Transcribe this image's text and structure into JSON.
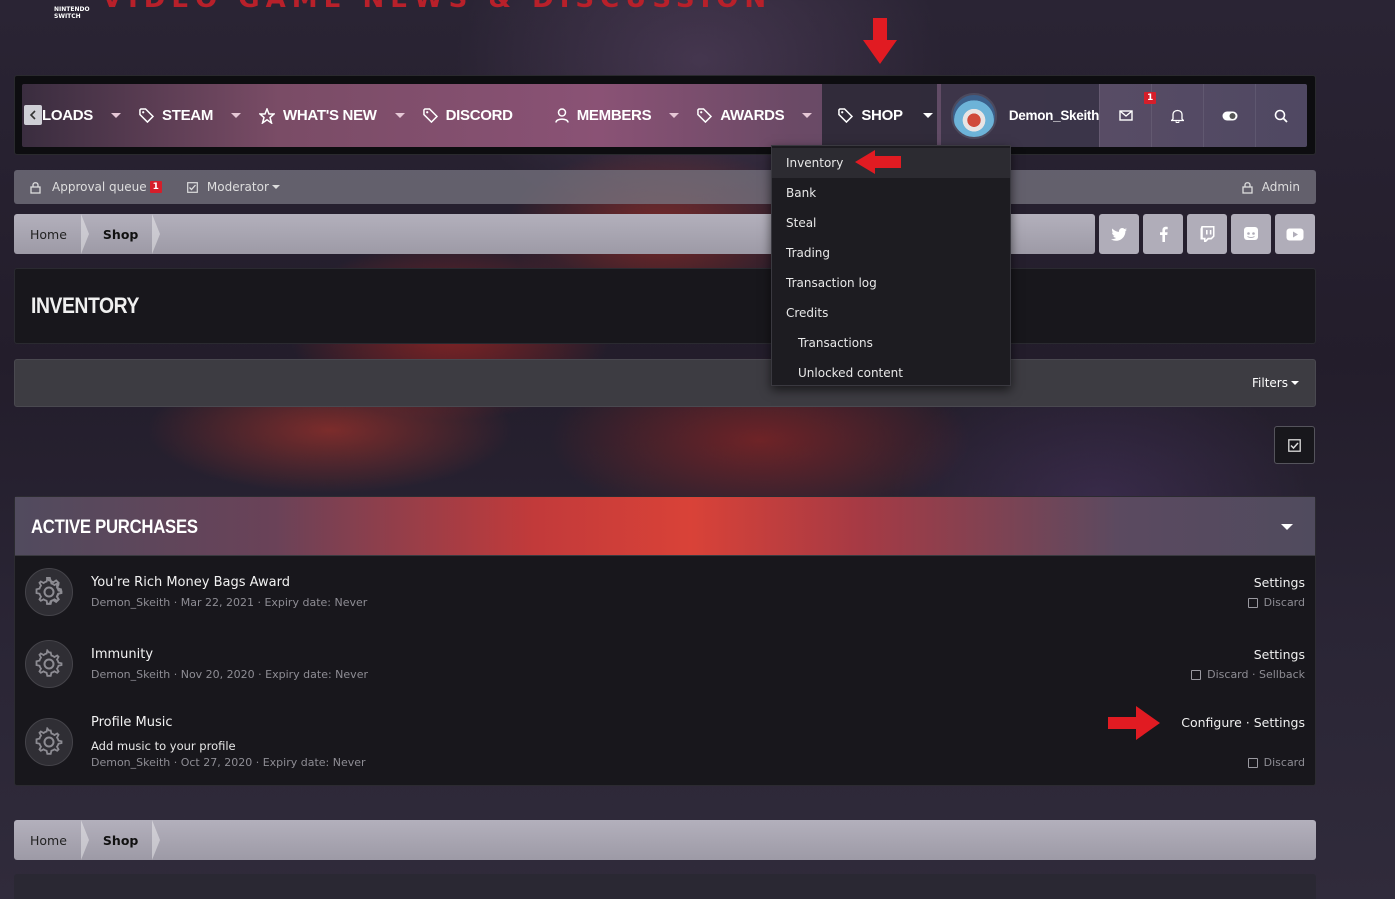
{
  "header": {
    "logo_text": "NINTENDO SWITCH",
    "tagline": "VIDEO GAME NEWS & DISCUSSION"
  },
  "nav": {
    "items": [
      {
        "label": "LOADS",
        "icon": "none"
      },
      {
        "label": "STEAM",
        "icon": "tag-icon"
      },
      {
        "label": "WHAT'S NEW",
        "icon": "star-icon"
      },
      {
        "label": "DISCORD",
        "icon": "tag-icon"
      },
      {
        "label": "MEMBERS",
        "icon": "user-icon"
      },
      {
        "label": "AWARDS",
        "icon": "tag-icon"
      },
      {
        "label": "SHOP",
        "icon": "tag-icon"
      }
    ],
    "username": "Demon_Skeith",
    "inbox_badge": "1"
  },
  "modbar": {
    "approval_label": "Approval queue",
    "approval_badge": "1",
    "moderator_label": "Moderator",
    "admin_label": "Admin"
  },
  "breadcrumb": {
    "home": "Home",
    "shop": "Shop"
  },
  "shop_menu": {
    "items": [
      "Inventory",
      "Bank",
      "Steal",
      "Trading",
      "Transaction log",
      "Credits"
    ],
    "sub_items": [
      "Transactions",
      "Unlocked content"
    ]
  },
  "page": {
    "title": "INVENTORY",
    "filters_label": "Filters"
  },
  "active_purchases": {
    "title": "ACTIVE PURCHASES",
    "rows": [
      {
        "title": "You're Rich Money Bags Award",
        "meta": "Demon_Skeith · Mar 22, 2021 · Expiry date: Never",
        "actions": "Settings",
        "secondary": "Discard",
        "description": ""
      },
      {
        "title": "Immunity",
        "meta": "Demon_Skeith · Nov 20, 2020 · Expiry date: Never",
        "actions": "Settings",
        "secondary": "Discard · Sellback",
        "description": ""
      },
      {
        "title": "Profile Music",
        "meta": "Demon_Skeith · Oct 27, 2020 · Expiry date: Never",
        "actions": "Configure · Settings",
        "secondary": "Discard",
        "description": "Add music to your profile"
      }
    ]
  },
  "colors": {
    "accent_red": "#e11b22",
    "badge_red": "#d51e2a"
  }
}
